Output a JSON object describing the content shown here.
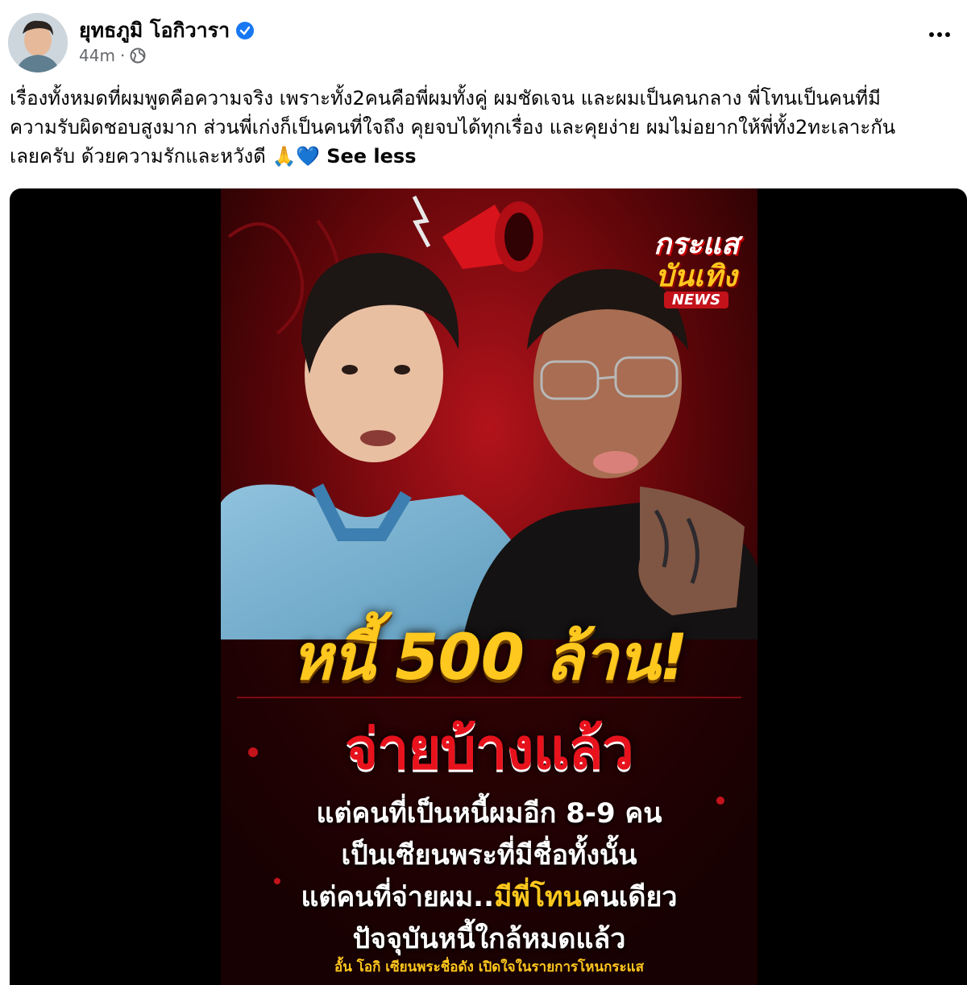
{
  "post": {
    "author": "ยุทธภูมิ โอกิวารา",
    "timestamp": "44m",
    "separator": "·",
    "text_lines": [
      "เรื่องทั้งหมดที่ผมพูดคือความจริง เพราะทั้ง2คนคือพี่ผมทั้งคู่ ผมชัดเจน และผมเป็นคนกลาง พี่โทนเป็นคนที่มี",
      "ความรับผิดชอบสูงมาก ส่วนพี่เก่งก็เป็นคนที่ใจถึง คุยจบได้ทุกเรื่อง และคุยง่าย ผมไม่อยากให้พี่ทั้ง2ทะเลาะกัน",
      "เลยครับ ด้วยความรักและหวังดี 🙏💙"
    ],
    "see_less": "See less"
  },
  "poster": {
    "logo_line1": "กระแส",
    "logo_line2": "บันเทิง",
    "logo_line3": "NEWS",
    "headline1": "หนี้ 500 ล้าน!",
    "headline2": "จ่ายบ้างแล้ว",
    "sub1": "แต่คนที่เป็นหนี้ผมอีก 8-9 คน",
    "sub2": "เป็นเซียนพระที่มีชื่อทั้งนั้น",
    "sub3_pre": "แต่คนที่จ่ายผม..",
    "sub3_hl": "มีพี่โทน",
    "sub3_post": "คนเดียว",
    "sub4": "ปัจจุบันหนี้ใกล้หมดแล้ว",
    "credit": "อั้น โอกิ เซียนพระชื่อดัง เปิดใจในรายการโหนกระแส"
  },
  "icons": {
    "verified": "verified-badge-icon",
    "audience": "globe-icon",
    "more": "more-options-icon"
  },
  "colors": {
    "verified_blue": "#1877f2",
    "meta_gray": "#65676b",
    "headline_yellow": "#ffc81e",
    "headline_red": "#e8121c"
  }
}
